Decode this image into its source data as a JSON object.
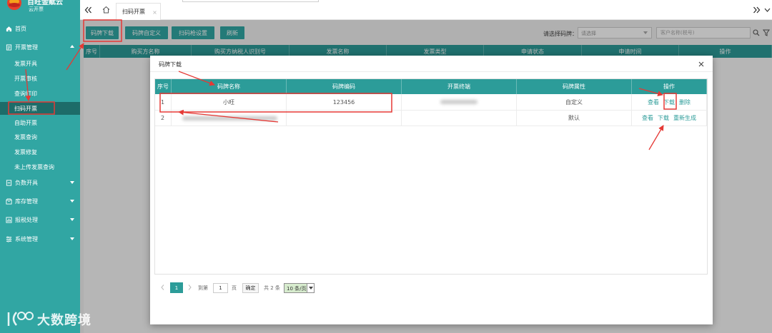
{
  "brand": {
    "name": "百旺金赋云",
    "product": "云开票"
  },
  "colors": {
    "accent": "#2c9c99",
    "sidebar": "#31a6a3",
    "sidebar_active": "#1d6c69",
    "annotation_red": "#e53935"
  },
  "sidebar": {
    "home": {
      "label": "首页",
      "icon": "home-icon"
    },
    "groups": [
      {
        "label": "开票管理",
        "icon": "invoice-icon",
        "expanded": true,
        "active_index": 3,
        "items": [
          "发票开具",
          "开票审核",
          "查询打印",
          "扫码开票",
          "自助开票",
          "发票查询",
          "发票修复",
          "未上传发票查询"
        ]
      },
      {
        "label": "负数开具",
        "icon": "negative-invoice-icon",
        "expanded": false
      },
      {
        "label": "库存管理",
        "icon": "inventory-icon",
        "expanded": false
      },
      {
        "label": "报税处理",
        "icon": "tax-report-icon",
        "expanded": false
      },
      {
        "label": "系统管理",
        "icon": "system-settings-icon",
        "expanded": false
      }
    ]
  },
  "topbar": {
    "icons": {
      "collapse": "double-chevron-left-icon",
      "home": "home-icon",
      "scroll_right": "double-chevron-right-icon",
      "more": "chevron-down-icon"
    },
    "tabs": [
      {
        "label": "扫码开票",
        "closable": true,
        "active": true
      }
    ]
  },
  "toolbar": {
    "buttons": [
      "码牌下载",
      "码牌自定义",
      "扫码枪设置",
      "刷新"
    ],
    "code_select_label": "请选择码牌：",
    "code_select_value": "请选择",
    "search_placeholder": "客户名称(税号)",
    "icons": {
      "search": "search-icon",
      "filter": "filter-icon"
    }
  },
  "list_table": {
    "columns": [
      "序号",
      "购买方名称",
      "购买方纳税人识别号",
      "发票名称",
      "发票类型",
      "申请状态",
      "申请时间",
      "操作"
    ]
  },
  "modal": {
    "title": "码牌下载",
    "columns": [
      "序号",
      "码牌名称",
      "码牌编码",
      "开票终端",
      "码牌属性",
      "操作"
    ],
    "rows": [
      {
        "index": "1",
        "name": "小旺",
        "code": "123456",
        "attribute": "自定义",
        "actions": [
          "查看",
          "下载",
          "删除"
        ]
      },
      {
        "index": "2",
        "attribute": "默认",
        "actions": [
          "查看",
          "下载",
          "重新生成"
        ]
      }
    ],
    "pagination": {
      "current_page": "1",
      "goto_label": "到第",
      "goto_value": "1",
      "page_unit": "页",
      "confirm_label": "确定",
      "total_label": "共 2 条",
      "page_size": "10 条/页"
    }
  },
  "watermark": {
    "text": "大数跨境"
  }
}
